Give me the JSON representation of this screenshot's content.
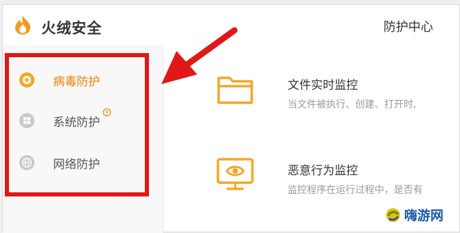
{
  "app": {
    "title": "火绒安全"
  },
  "header": {
    "page_title": "防护中心"
  },
  "sidebar": {
    "items": [
      {
        "label": "病毒防护",
        "icon": "shield-plus-icon",
        "active": true
      },
      {
        "label": "系统防护",
        "icon": "windows-icon",
        "active": false,
        "badge": "warning-icon"
      },
      {
        "label": "网络防护",
        "icon": "globe-icon",
        "active": false
      }
    ]
  },
  "features": [
    {
      "title": "文件实时监控",
      "desc": "当文件被执行、创建、打开时,",
      "icon": "folder-icon"
    },
    {
      "title": "恶意行为监控",
      "desc": "监控程序在运行过程中，是否有",
      "icon": "monitor-eye-icon"
    }
  ],
  "watermark": {
    "text": "嗨游网"
  },
  "colors": {
    "accent": "#f08000",
    "highlight": "#e01818",
    "watermark": "#1b5aa8"
  }
}
